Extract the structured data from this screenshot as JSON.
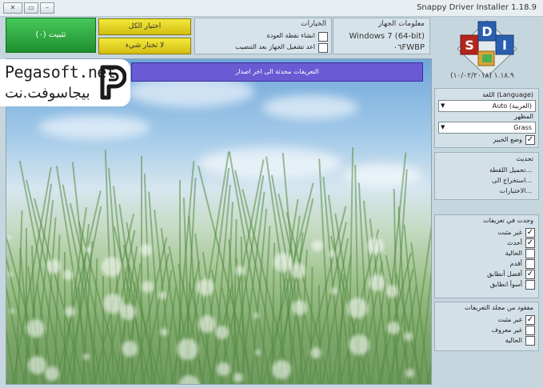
{
  "window": {
    "title": "Snappy Driver Installer 1.18.9"
  },
  "toolbar": {
    "install_label": "تثبيت (٠)",
    "select_all_label": "اختيار الكل",
    "select_none_label": "لا تختار شيء"
  },
  "options": {
    "title": "الخيارات",
    "items": [
      {
        "label": "انشاء نقطة العودة",
        "checked": false
      },
      {
        "label": "اعد تشغيل الجهاز بعد التنصيب",
        "checked": false
      }
    ]
  },
  "system_info": {
    "title": "معلومات الجهاز",
    "os": "Windows 7 (64-bit)",
    "machine": "٠٦FWBP"
  },
  "logo": {
    "letters": [
      "S",
      "D",
      "I"
    ]
  },
  "version_text": "١.١٨.٩ (١٠/٠٢/٢٠١٨)",
  "main": {
    "notice": "التعريفات محدثة الى اخر اصدار"
  },
  "watermark": {
    "latin": "Pegasoft.net",
    "arabic": "بيجاسوفت.نت"
  },
  "sidebar": {
    "language_label": "اللغة (Language)",
    "language_value": "Auto (العربية)",
    "theme_label": "المظهر",
    "theme_value": "Grass",
    "expert_mode": {
      "label": "وضع الخبير",
      "checked": true
    },
    "update_title": "تحديث",
    "links": [
      "تحميل اللقطة...",
      "استخراج الى...",
      "الاختيارات..."
    ],
    "found_title": "وجدت في تعريفات",
    "found_items": [
      {
        "label": "غير مثبت",
        "checked": true
      },
      {
        "label": "أحدث",
        "checked": true
      },
      {
        "label": "الحالية",
        "checked": false
      },
      {
        "label": "أقدم",
        "checked": false
      },
      {
        "label": "أفضل أنطابق",
        "checked": true
      },
      {
        "label": "أسوأ انطابق",
        "checked": false
      }
    ],
    "missing_title": "مفقود من مجلد التعريفات",
    "missing_items": [
      {
        "label": "غير مثبت",
        "checked": true
      },
      {
        "label": "غير معروف",
        "checked": false
      },
      {
        "label": "الحالية",
        "checked": false
      }
    ]
  }
}
